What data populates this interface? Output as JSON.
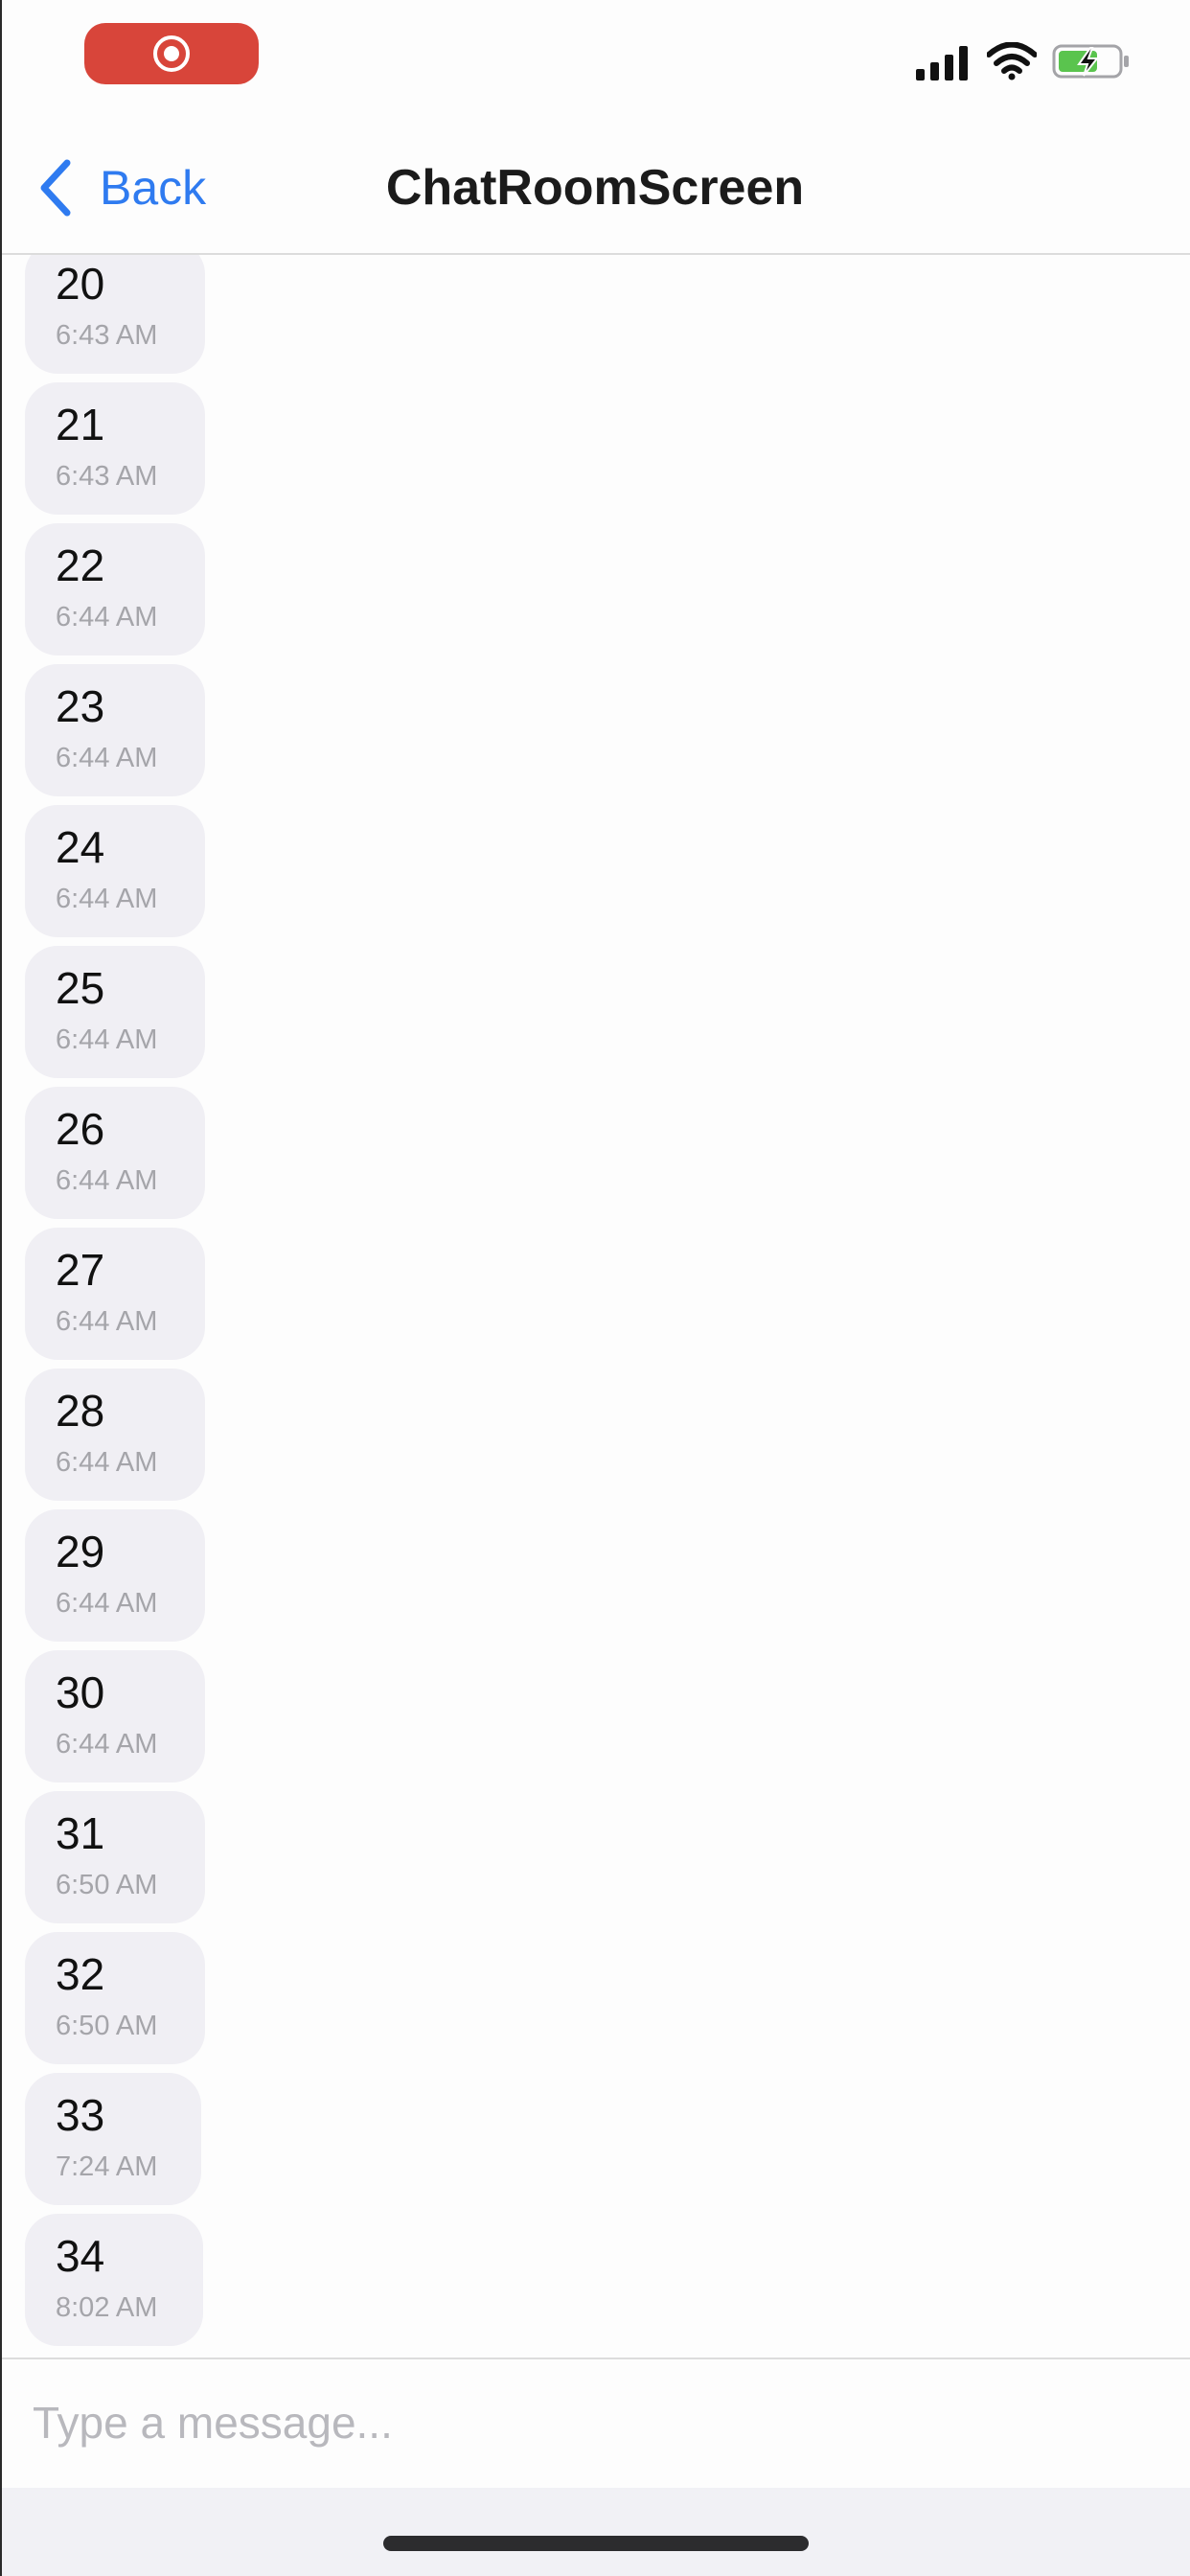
{
  "status_bar": {
    "recording_color": "#d8453a",
    "icons": [
      "record-icon",
      "cellular-signal-icon",
      "wifi-icon",
      "battery-charging-icon"
    ],
    "battery_color": "#5ac44e"
  },
  "header": {
    "back_label": "Back",
    "title": "ChatRoomScreen",
    "accent_color": "#2f7bf0"
  },
  "messages": [
    {
      "text": "20",
      "time": "6:43 AM"
    },
    {
      "text": "21",
      "time": "6:43 AM"
    },
    {
      "text": "22",
      "time": "6:44 AM"
    },
    {
      "text": "23",
      "time": "6:44 AM"
    },
    {
      "text": "24",
      "time": "6:44 AM"
    },
    {
      "text": "25",
      "time": "6:44 AM"
    },
    {
      "text": "26",
      "time": "6:44 AM"
    },
    {
      "text": "27",
      "time": "6:44 AM"
    },
    {
      "text": "28",
      "time": "6:44 AM"
    },
    {
      "text": "29",
      "time": "6:44 AM"
    },
    {
      "text": "30",
      "time": "6:44 AM"
    },
    {
      "text": "31",
      "time": "6:50 AM"
    },
    {
      "text": "32",
      "time": "6:50 AM"
    },
    {
      "text": "33",
      "time": "7:24 AM"
    },
    {
      "text": "34",
      "time": "8:02 AM"
    }
  ],
  "composer": {
    "placeholder": "Type a message...",
    "value": ""
  }
}
